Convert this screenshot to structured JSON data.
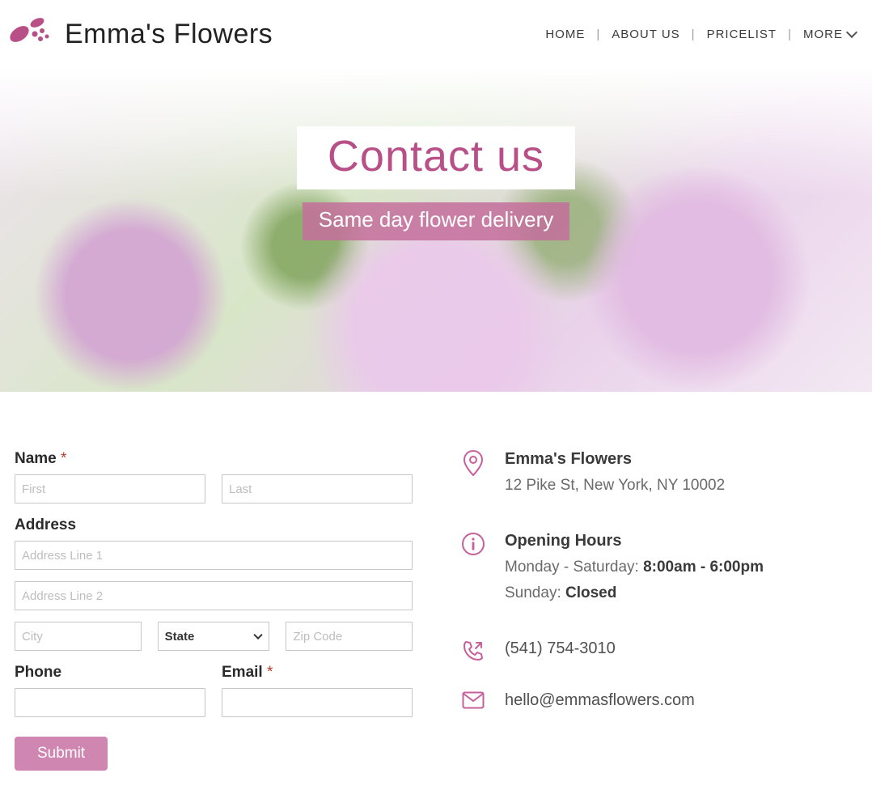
{
  "brand": {
    "name": "Emma's Flowers"
  },
  "nav": {
    "items": [
      "HOME",
      "ABOUT US",
      "PRICELIST"
    ],
    "more": "MORE"
  },
  "hero": {
    "title": "Contact us",
    "subtitle": "Same day flower delivery"
  },
  "form": {
    "name_label": "Name",
    "address_label": "Address",
    "phone_label": "Phone",
    "email_label": "Email",
    "placeholders": {
      "first": "First",
      "last": "Last",
      "addr1": "Address Line 1",
      "addr2": "Address Line 2",
      "city": "City",
      "state": "State",
      "zip": "Zip Code"
    },
    "submit": "Submit"
  },
  "info": {
    "business_name": "Emma's Flowers",
    "address": "12 Pike St, New York, NY 10002",
    "hours_title": "Opening Hours",
    "hours_weekday_label": "Monday - Saturday: ",
    "hours_weekday_value": "8:00am - 6:00pm",
    "hours_sunday_label": "Sunday: ",
    "hours_sunday_value": "Closed",
    "phone": "(541) 754-3010",
    "email": "hello@emmasflowers.com"
  }
}
